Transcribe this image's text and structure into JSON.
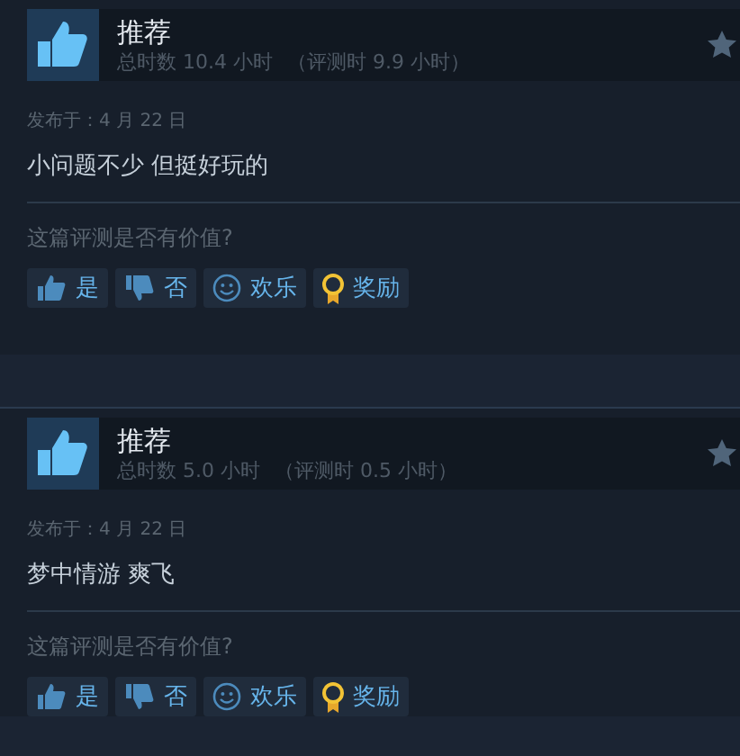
{
  "reviews": [
    {
      "title": "推荐",
      "recommended": true,
      "hours": "总时数 10.4 小时",
      "review_hours": "（评测时 9.9 小时）",
      "posted": "发布于：4 月 22 日",
      "text": "小问题不少 但挺好玩的",
      "question": "这篇评测是否有价值?",
      "buttons": [
        {
          "kind": "yes",
          "label": "是"
        },
        {
          "kind": "no",
          "label": "否"
        },
        {
          "kind": "funny",
          "label": "欢乐"
        },
        {
          "kind": "award",
          "label": "奖励"
        }
      ]
    },
    {
      "title": "推荐",
      "recommended": true,
      "hours": "总时数 5.0 小时",
      "review_hours": "（评测时 0.5 小时）",
      "posted": "发布于：4 月 22 日",
      "text": "梦中情游 爽飞",
      "question": "这篇评测是否有价值?",
      "buttons": [
        {
          "kind": "yes",
          "label": "是"
        },
        {
          "kind": "no",
          "label": "否"
        },
        {
          "kind": "funny",
          "label": "欢乐"
        },
        {
          "kind": "award",
          "label": "奖励"
        }
      ]
    }
  ]
}
